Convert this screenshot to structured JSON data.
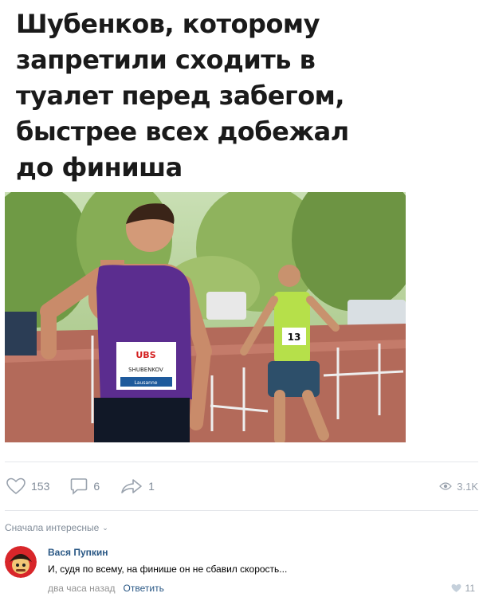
{
  "post": {
    "title": "Шубенков, которому\nзапретили сходить в\nтуалет перед забегом,\nбыстрее всех добежал\nдо финиша",
    "photo_bib_front": "UBS",
    "photo_bib_name": "SHUBENKOV",
    "photo_bib_brand": "Lausanne",
    "photo_runner_number": "13"
  },
  "actions": {
    "likes": "153",
    "comments": "6",
    "shares": "1",
    "views": "3.1K"
  },
  "comments_section": {
    "sort_label": "Сначала интересные",
    "items": [
      {
        "author": "Вася Пупкин",
        "text": "И, судя по всему, на финише он не сбавил скорость...",
        "time": "два часа назад",
        "reply_label": "Ответить",
        "likes": "11"
      }
    ]
  },
  "colors": {
    "link": "#2a5885",
    "muted": "#818c99",
    "icon": "#99a2ad"
  }
}
